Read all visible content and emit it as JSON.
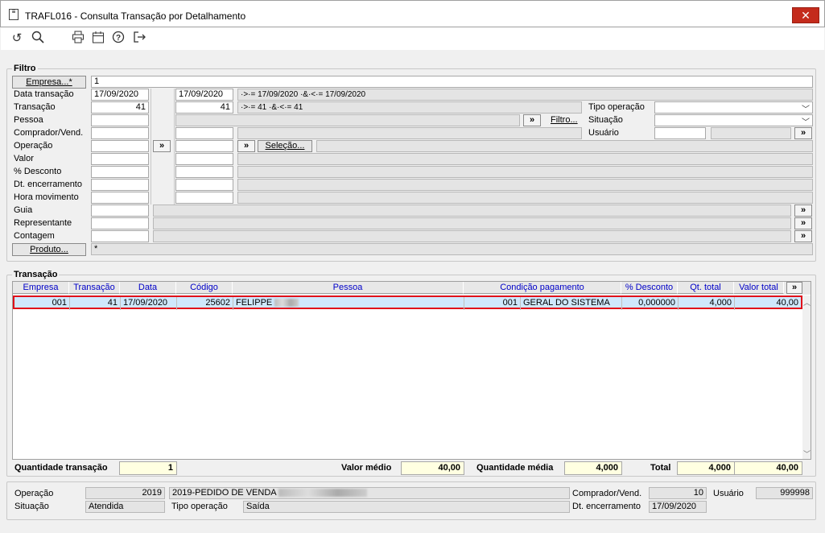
{
  "window": {
    "title": "TRAFL016 - Consulta Transação por Detalhamento",
    "close": "✕"
  },
  "filtro": {
    "title": "Filtro",
    "empresa_btn": "Empresa...*",
    "empresa_value": "1",
    "labels": {
      "data_transacao": "Data transação",
      "transacao": "Transação",
      "pessoa": "Pessoa",
      "comprador": "Comprador/Vend.",
      "operacao": "Operação",
      "valor": "Valor",
      "desconto": "% Desconto",
      "dt_encerramento": "Dt. encerramento",
      "hora_movimento": "Hora movimento",
      "guia": "Guia",
      "representante": "Representante",
      "contagem": "Contagem",
      "tipo_operacao": "Tipo operação",
      "situacao": "Situação",
      "usuario": "Usuário"
    },
    "data_de": "17/09/2020",
    "data_ate": "17/09/2020",
    "data_expr": "·>·= 17/09/2020 ·&·<·= 17/09/2020",
    "trans_de": "41",
    "trans_ate": "41",
    "trans_expr": "·>·= 41 ·&·<·= 41",
    "filtro_btn": "Filtro...",
    "selecao_btn": "Seleção...",
    "produto_btn": "Produto...",
    "produto_value": "*",
    "arrow": "»"
  },
  "transacao": {
    "title": "Transação",
    "columns": [
      "Empresa",
      "Transação",
      "Data",
      "Código",
      "Pessoa",
      "Condição pagamento",
      "% Desconto",
      "Qt. total",
      "Valor total"
    ],
    "row": {
      "empresa": "001",
      "transacao": "41",
      "data": "17/09/2020",
      "codigo": "25602",
      "pessoa": "FELIPPE",
      "cond_cod": "001",
      "cond_desc": "GERAL DO SISTEMA",
      "desconto": "0,000000",
      "qt_total": "4,000",
      "valor_total": "40,00"
    }
  },
  "totais": {
    "qtd_transacao_label": "Quantidade transação",
    "qtd_transacao": "1",
    "valor_medio_label": "Valor médio",
    "valor_medio": "40,00",
    "qtd_media_label": "Quantidade média",
    "qtd_media": "4,000",
    "total_label": "Total",
    "total_qt": "4,000",
    "total_valor": "40,00"
  },
  "detalhe": {
    "operacao_label": "Operação",
    "operacao_cod": "2019",
    "operacao_desc": "2019-PEDIDO DE VENDA",
    "comprador_label": "Comprador/Vend.",
    "comprador": "10",
    "usuario_label": "Usuário",
    "usuario": "999998",
    "situacao_label": "Situação",
    "situacao": "Atendida",
    "tipo_label": "Tipo operação",
    "tipo": "Saída",
    "dt_enc_label": "Dt. encerramento",
    "dt_enc": "17/09/2020"
  }
}
